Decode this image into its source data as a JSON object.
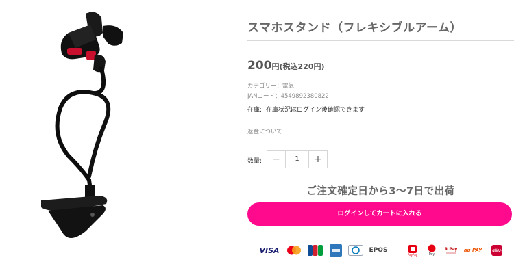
{
  "product": {
    "title": "スマホスタンド（フレキシブルアーム）",
    "price_main": "200",
    "price_yen": "円",
    "price_tax": "(税込220円)",
    "category_line": "カテゴリー：電気",
    "jan_line": "JANコード：4549892380822",
    "stock_label": "在庫:",
    "stock_value": "在庫状況はログイン後確認できます",
    "refund_link": "返金について"
  },
  "quantity": {
    "label": "数量:",
    "value": "1",
    "minus": "−",
    "plus": "+"
  },
  "shipping_note": "ご注文確定日から3〜7日で出荷",
  "cart_button": "ログインしてカートに入れる",
  "payment_methods": [
    "VISA",
    "Mastercard",
    "JCB",
    "AMERICAN EXPRESS",
    "Diners Club",
    "EPOS",
    "PayPay",
    "Pay",
    "Pay",
    "au PAY",
    "d払い"
  ],
  "payment_labels": {
    "visa": "VISA",
    "epos": "EPOS",
    "paypay": "PayPay",
    "merpay": "Pay",
    "rakuten": "R Pay",
    "aupay": "au PAY",
    "dbarai": "d払い"
  },
  "colors": {
    "accent": "#ff0a8c",
    "visa": "#1a1f71",
    "paypay": "#e60012",
    "aupay": "#eb5505"
  }
}
